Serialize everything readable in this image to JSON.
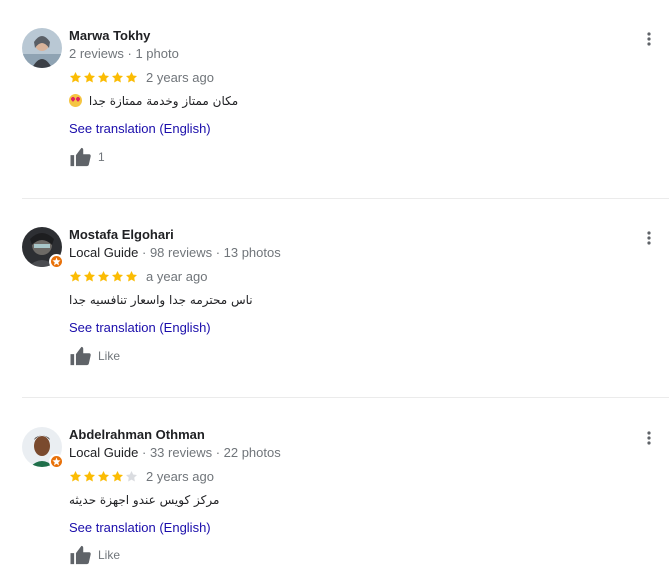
{
  "colors": {
    "star_filled": "#fbbc04",
    "star_empty": "#dadce0",
    "link": "#1a0dab",
    "guide_badge": "#e8710a"
  },
  "reviews": [
    {
      "name": "Marwa Tokhy",
      "meta": "2 reviews · 1 photo",
      "guide": "",
      "rating": 5,
      "date": "2 years ago",
      "text": "مكان ممتاز وخدمة ممتازة جدا",
      "emoji": "heart-eyes-emoji",
      "translate": "See translation (English)",
      "like_label": "1"
    },
    {
      "name": "Mostafa Elgohari",
      "meta": " · 98 reviews · 13 photos",
      "guide": "Local Guide",
      "rating": 5,
      "date": "a year ago",
      "text": "ناس محترمه جدا واسعار تنافسيه جدا",
      "translate": "See translation (English)",
      "like_label": "Like"
    },
    {
      "name": "Abdelrahman Othman",
      "meta": " · 33 reviews · 22 photos",
      "guide": "Local Guide",
      "rating": 4,
      "date": "2 years ago",
      "text": "مركز كويس عندو اجهزة حديثه",
      "translate": "See translation (English)",
      "like_label": "Like"
    }
  ]
}
